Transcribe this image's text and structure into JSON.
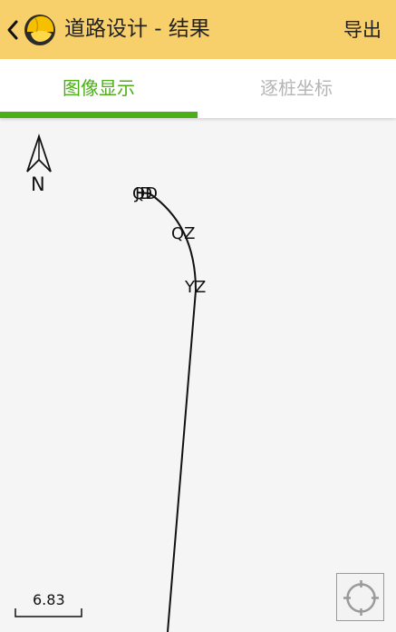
{
  "header": {
    "back_icon": "chevron-left-icon",
    "logo_icon": "hard-hat-logo",
    "title": "道路设计 - 结果",
    "export_label": "导出",
    "background_color": "#f7cf6b"
  },
  "tabs": [
    {
      "label": "图像显示",
      "active": true
    },
    {
      "label": "逐桩坐标",
      "active": false
    }
  ],
  "accent_color": "#4caf17",
  "map": {
    "north_label": "N",
    "points": {
      "qd": "QD",
      "jd": "JD",
      "qz": "QZ",
      "yz": "YZ"
    },
    "scale_value": "6.83",
    "locate_icon": "crosshair-icon"
  }
}
